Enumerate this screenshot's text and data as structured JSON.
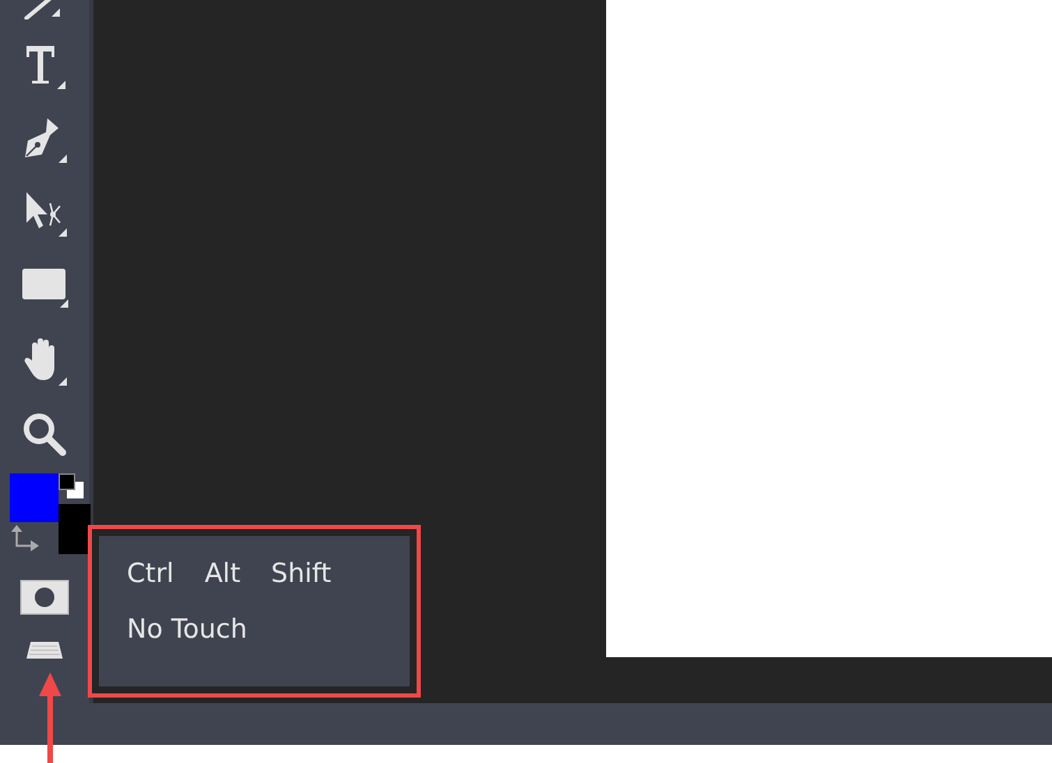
{
  "toolbar": {
    "swatches": [
      {
        "kind": "foreground",
        "color": "#0000ff"
      },
      {
        "kind": "background",
        "color": "#000000"
      }
    ]
  },
  "popup": {
    "modifiers": [
      {
        "label": "Ctrl"
      },
      {
        "label": "Alt"
      },
      {
        "label": "Shift"
      }
    ],
    "touch_option": "No Touch"
  }
}
